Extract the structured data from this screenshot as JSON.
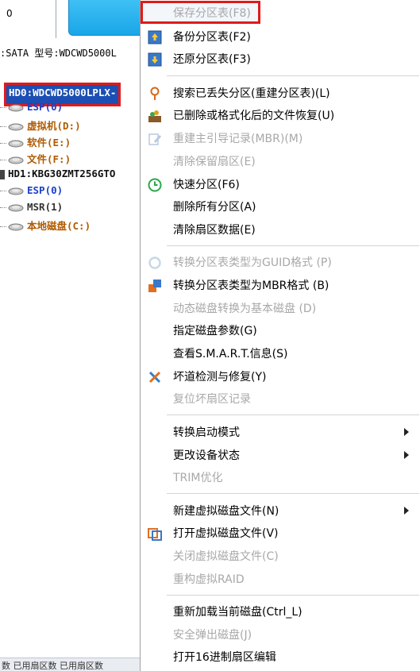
{
  "left": {
    "disk_count": "0",
    "disk_info": ":SATA  型号:WDCWD5000L",
    "tree": {
      "hd0": "HD0:WDCWD5000LPLX-",
      "hd0_parts": [
        "ESP(0)",
        "虚拟机(D:)",
        "软件(E:)",
        "文件(F:)"
      ],
      "hd1": "HD1:KBG30ZMT256GTO",
      "hd1_parts": [
        "ESP(0)",
        "MSR(1)",
        "本地磁盘(C:)"
      ]
    },
    "status_text": "数 已用扇区数 已用扇区数"
  },
  "menu": {
    "items": [
      {
        "label": "保存分区表(F8)"
      },
      {
        "label": "备份分区表(F2)"
      },
      {
        "label": "还原分区表(F3)"
      },
      {
        "label": "搜索已丢失分区(重建分区表)(L)"
      },
      {
        "label": "已删除或格式化后的文件恢复(U)"
      },
      {
        "label": "重建主引导记录(MBR)(M)"
      },
      {
        "label": "清除保留扇区(E)"
      },
      {
        "label": "快速分区(F6)"
      },
      {
        "label": "删除所有分区(A)"
      },
      {
        "label": "清除扇区数据(E)"
      },
      {
        "label": "转换分区表类型为GUID格式 (P)"
      },
      {
        "label": "转换分区表类型为MBR格式 (B)"
      },
      {
        "label": "动态磁盘转换为基本磁盘 (D)"
      },
      {
        "label": "指定磁盘参数(G)"
      },
      {
        "label": "查看S.M.A.R.T.信息(S)"
      },
      {
        "label": "坏道检测与修复(Y)"
      },
      {
        "label": "复位坏扇区记录"
      },
      {
        "label": "转换启动模式"
      },
      {
        "label": "更改设备状态"
      },
      {
        "label": "TRIM优化"
      },
      {
        "label": "新建虚拟磁盘文件(N)"
      },
      {
        "label": "打开虚拟磁盘文件(V)"
      },
      {
        "label": "关闭虚拟磁盘文件(C)"
      },
      {
        "label": "重构虚拟RAID"
      },
      {
        "label": "重新加载当前磁盘(Ctrl_L)"
      },
      {
        "label": "安全弹出磁盘(J)"
      },
      {
        "label": "打开16进制扇区编辑"
      }
    ]
  },
  "colors": {
    "accent_red": "#e01a1a",
    "selection_blue": "#1c4fb3",
    "disabled_text": "#a8a8a8"
  }
}
